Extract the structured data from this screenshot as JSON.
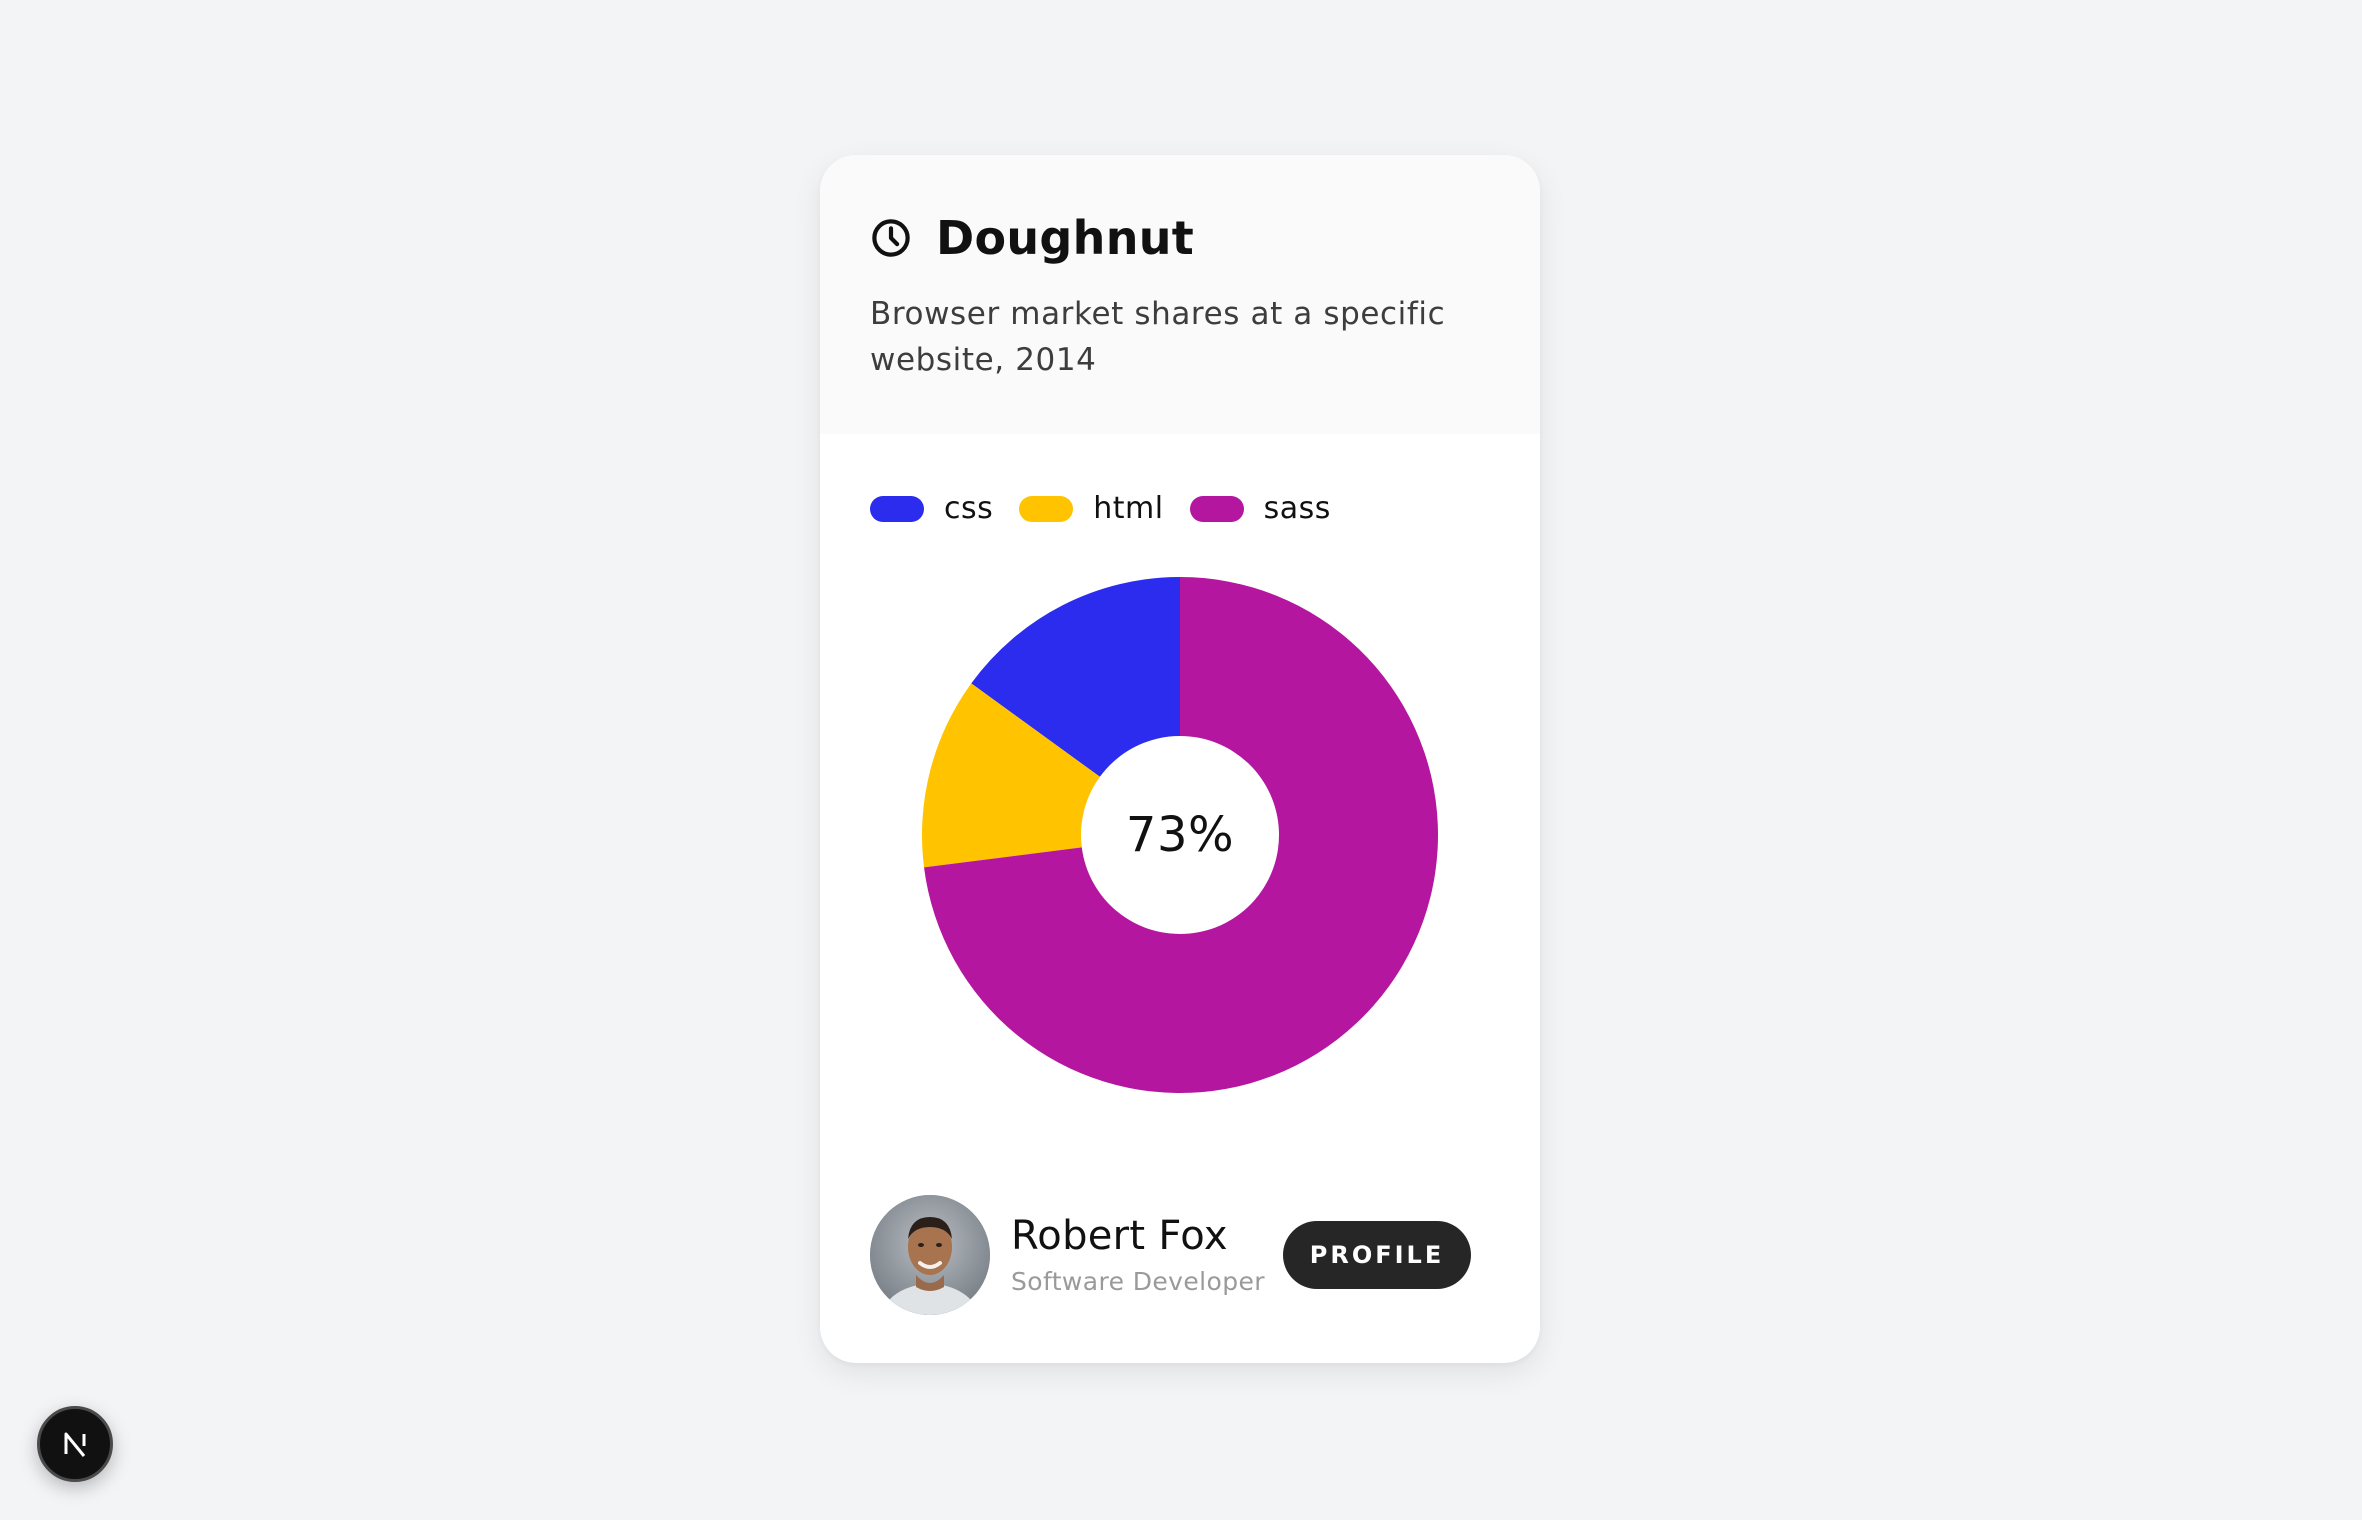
{
  "card": {
    "title": "Doughnut",
    "subtitle": "Browser market shares at a specific website, 2014",
    "center_label": "73%"
  },
  "chart_data": {
    "type": "pie",
    "variant": "doughnut",
    "title": "Doughnut",
    "subtitle": "Browser market shares at a specific website, 2014",
    "series": [
      {
        "name": "css",
        "value": 15,
        "color": "#2b2ced"
      },
      {
        "name": "html",
        "value": 12,
        "color": "#ffc300"
      },
      {
        "name": "sass",
        "value": 73,
        "color": "#b416a0"
      }
    ],
    "legend_position": "top-left",
    "center_text": "73%"
  },
  "user": {
    "name": "Robert Fox",
    "role": "Software Developer"
  },
  "actions": {
    "profile_label": "PROFILE"
  },
  "icons": {
    "header": "clock-icon",
    "fab": "next-logo-icon"
  }
}
